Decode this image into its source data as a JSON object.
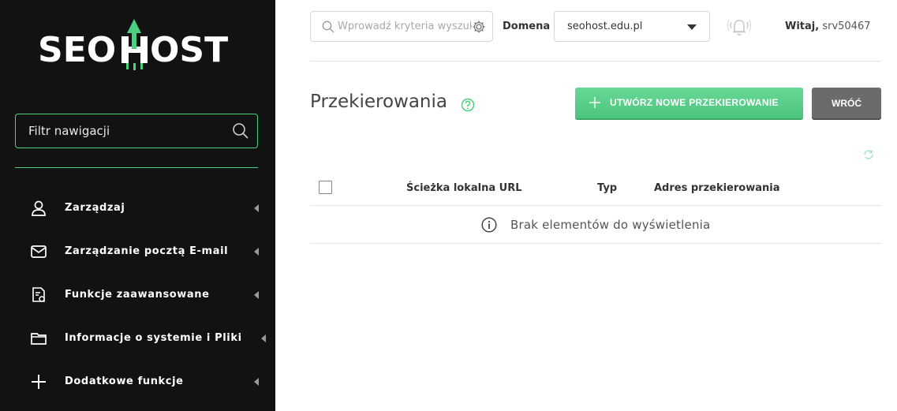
{
  "brand": {
    "logo_text_left": "SEO",
    "logo_text_right": "OST",
    "accent_color": "#4ad07f"
  },
  "sidebar": {
    "filter_placeholder": "Filtr nawigacji",
    "items": [
      {
        "label": "Zarządzaj",
        "icon": "user-icon"
      },
      {
        "label": "Zarządzanie pocztą E-mail",
        "icon": "mail-icon"
      },
      {
        "label": "Funkcje zaawansowane",
        "icon": "document-gear-icon"
      },
      {
        "label": "Informacje o systemie i Pliki",
        "icon": "folder-icon"
      },
      {
        "label": "Dodatkowe funkcje",
        "icon": "plus-icon"
      }
    ]
  },
  "header": {
    "search_placeholder": "Wprowadź kryteria wyszukiwania",
    "domain_label": "Domena",
    "domain_value": "seohost.edu.pl",
    "welcome_prefix": "Witaj,",
    "username": "srv50467"
  },
  "page": {
    "title": "Przekierowania",
    "create_button": "UTWÓRZ NOWE PRZEKIEROWANIE",
    "back_button": "WRÓĆ"
  },
  "table": {
    "columns": [
      "Ścieżka lokalna URL",
      "Typ",
      "Adres przekierowania"
    ],
    "empty_message": "Brak elementów do wyświetlenia"
  }
}
